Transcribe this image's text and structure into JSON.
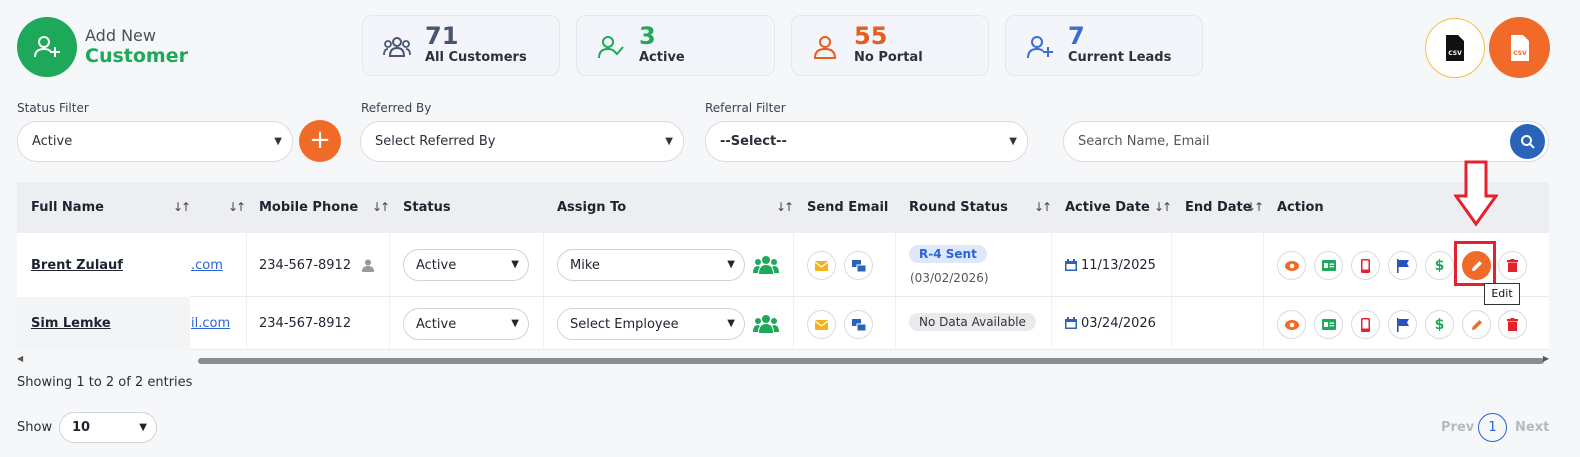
{
  "header": {
    "add_line1": "Add New",
    "add_line2": "Customer",
    "stats": [
      {
        "value": "71",
        "label": "All Customers",
        "color": "#4a5670"
      },
      {
        "value": "3",
        "label": "Active",
        "color": "#1ea85a"
      },
      {
        "value": "55",
        "label": "No Portal",
        "color": "#e85c1c"
      },
      {
        "value": "7",
        "label": "Current Leads",
        "color": "#3a6fd0"
      }
    ],
    "csv_label": "CSV"
  },
  "filters": {
    "status_label": "Status Filter",
    "status_value": "Active",
    "referred_label": "Referred By",
    "referred_value": "Select Referred By",
    "referral_label": "Referral Filter",
    "referral_value": "--Select--",
    "search_placeholder": "Search Name, Email"
  },
  "table": {
    "columns": [
      "Full Name",
      "Mobile Phone",
      "Status",
      "Assign To",
      "Send Email",
      "Round Status",
      "Active Date",
      "End Date",
      "Action"
    ],
    "rows": [
      {
        "name": "Brent Zulauf",
        "email_frag": ".com",
        "phone": "234-567-8912",
        "status": "Active",
        "assign": "Mike",
        "round": "R-4 Sent",
        "round_date": "(03/02/2026)",
        "active_date": "11/13/2025"
      },
      {
        "name": "Sim Lemke",
        "email_frag": "il.com",
        "phone": "234-567-8912",
        "status": "Active",
        "assign": "Select Employee",
        "round": "No Data Available",
        "active_date": "03/24/2026"
      }
    ]
  },
  "footer": {
    "showing": "Showing 1 to 2 of 2 entries",
    "show_label": "Show",
    "show_value": "10",
    "prev": "Prev",
    "page": "1",
    "next": "Next"
  },
  "tooltip": "Edit"
}
